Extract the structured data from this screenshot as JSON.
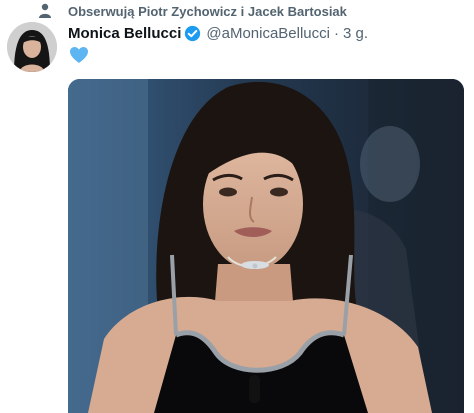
{
  "social_context": {
    "icon": "person-icon",
    "text": "Obserwują Piotr Zychowicz i Jacek Bartosiak"
  },
  "author": {
    "display_name": "Monica Bellucci",
    "verified_icon": "verified-badge-icon",
    "handle": "@aMonicaBellucci",
    "separator": "·",
    "time": "3 g."
  },
  "tweet": {
    "content_icon": "blue-heart-icon"
  },
  "colors": {
    "secondary_text": "#536471",
    "primary_text": "#0f1419",
    "verified": "#1d9bf0",
    "heart": "#5db5f2"
  }
}
